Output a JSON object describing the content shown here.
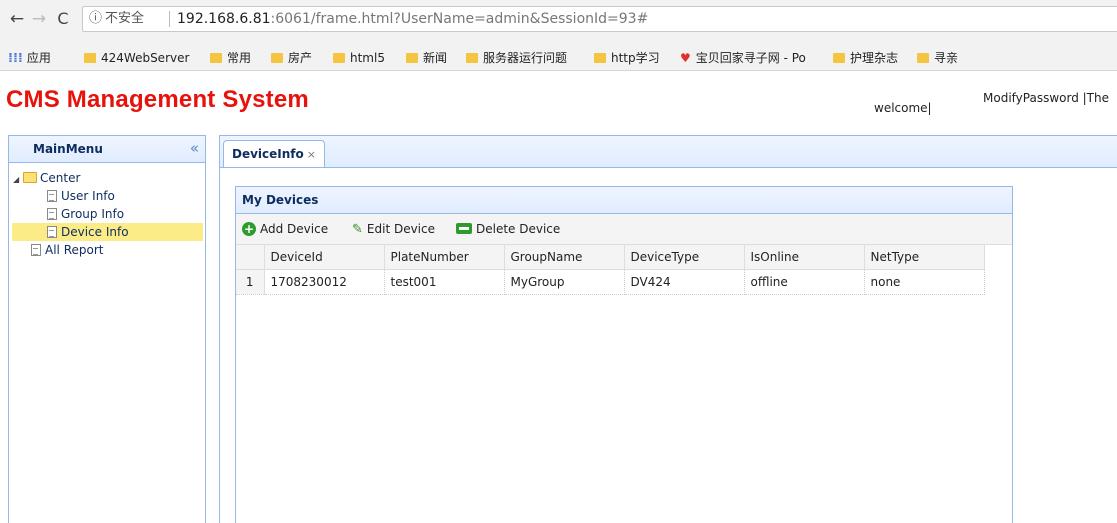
{
  "browser": {
    "nav": {
      "back": "←",
      "forward": "→",
      "reload": "C"
    },
    "security_icon": "ⓘ",
    "security_text": "不安全",
    "url_host": "192.168.6.81",
    "url_rest": ":6061/frame.html?UserName=admin&SessionId=93#",
    "bookmarks": [
      "应用",
      "424WebServer",
      "常用",
      "房产",
      "html5",
      "新闻",
      "服务器运行问题",
      "http学习",
      "宝贝回家寻子网 - Po",
      "护理杂志",
      "寻亲"
    ]
  },
  "header": {
    "title": "CMS Management System",
    "welcome": "welcome|",
    "modify": "ModifyPassword  |The"
  },
  "menu": {
    "title": "MainMenu",
    "collapse_icon": "«",
    "tree": {
      "root": "Center",
      "children": [
        "User Info",
        "Group Info",
        "Device Info"
      ],
      "sibling": "All Report"
    }
  },
  "tabs": [
    {
      "label": "DeviceInfo",
      "close": "×"
    }
  ],
  "devices_panel": {
    "title": "My Devices",
    "toolbar": {
      "add": "Add Device",
      "edit": "Edit Device",
      "delete": "Delete Device"
    },
    "columns": [
      "DeviceId",
      "PlateNumber",
      "GroupName",
      "DeviceType",
      "IsOnline",
      "NetType"
    ],
    "rows": [
      {
        "num": "1",
        "DeviceId": "1708230012",
        "PlateNumber": "test001",
        "GroupName": "MyGroup",
        "DeviceType": "DV424",
        "IsOnline": "offline",
        "NetType": "none"
      }
    ]
  },
  "colors": {
    "title_red": "#e8120c",
    "panel_border": "#95b8e7",
    "selected_node": "#fbec88",
    "icon_green": "#2e9b2e"
  }
}
